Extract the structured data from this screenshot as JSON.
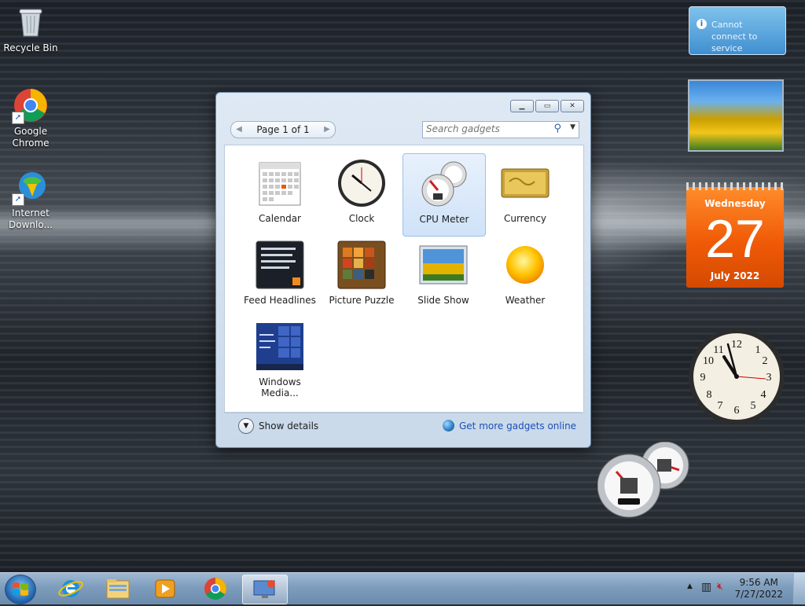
{
  "desktop": {
    "icons": [
      {
        "label": "Recycle Bin"
      },
      {
        "label": "Google Chrome"
      },
      {
        "label": "Internet Downlo..."
      }
    ]
  },
  "gallery": {
    "pager": {
      "text": "Page 1 of 1"
    },
    "search": {
      "placeholder": "Search gadgets"
    },
    "gadgets": [
      {
        "label": "Calendar",
        "icon": "calendar-icon"
      },
      {
        "label": "Clock",
        "icon": "clock-icon"
      },
      {
        "label": "CPU Meter",
        "icon": "cpu-meter-icon",
        "selected": true
      },
      {
        "label": "Currency",
        "icon": "currency-icon"
      },
      {
        "label": "Feed Headlines",
        "icon": "feed-headlines-icon"
      },
      {
        "label": "Picture Puzzle",
        "icon": "picture-puzzle-icon"
      },
      {
        "label": "Slide Show",
        "icon": "slide-show-icon"
      },
      {
        "label": "Weather",
        "icon": "weather-icon"
      },
      {
        "label": "Windows Media...",
        "icon": "windows-media-center-icon"
      }
    ],
    "footer": {
      "details": "Show details",
      "more": "Get more gadgets online"
    }
  },
  "sidebar": {
    "notice": "Cannot connect to service",
    "calendar": {
      "weekday": "Wednesday",
      "day": "27",
      "month": "July 2022"
    }
  },
  "taskbar": {
    "clock_time": "9:56 AM",
    "clock_date": "7/27/2022"
  },
  "colors": {
    "accent": "#3f8fd0",
    "calendar": "#f05a07",
    "link": "#1b4fb5"
  }
}
